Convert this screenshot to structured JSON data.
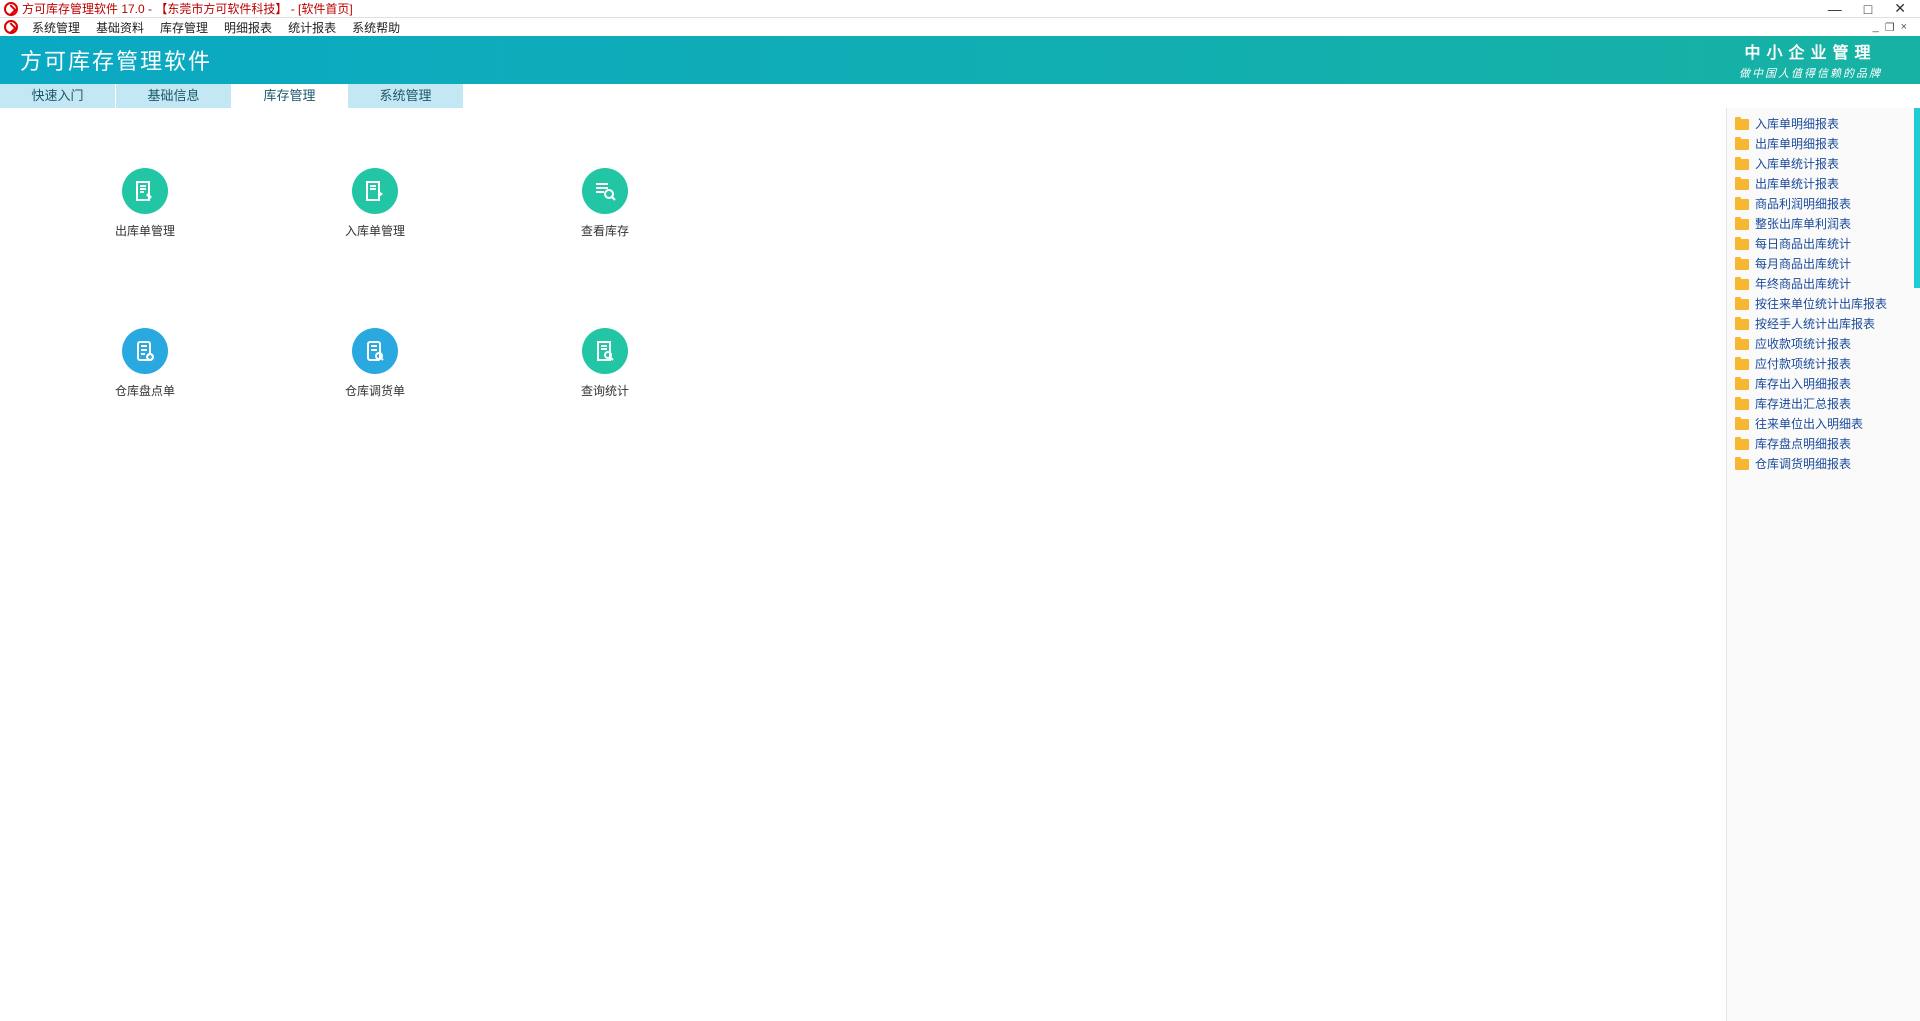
{
  "title_bar": {
    "text": "方可库存管理软件 17.0 - 【东莞市方可软件科技】 - [软件首页]"
  },
  "menu": [
    "系统管理",
    "基础资料",
    "库存管理",
    "明细报表",
    "统计报表",
    "系统帮助"
  ],
  "banner": {
    "brand": "方可库存管理软件",
    "right_line1": "中小企业管理",
    "right_line2": "做中国人值得信赖的品牌"
  },
  "tabs": [
    {
      "label": "快速入门",
      "active": false
    },
    {
      "label": "基础信息",
      "active": false
    },
    {
      "label": "库存管理",
      "active": true
    },
    {
      "label": "系统管理",
      "active": false
    }
  ],
  "icons": [
    {
      "label": "出库单管理",
      "color": "c-teal",
      "name": "outbound-orders",
      "glyph": "doc-pen"
    },
    {
      "label": "入库单管理",
      "color": "c-teal",
      "name": "inbound-orders",
      "glyph": "doc-arrow"
    },
    {
      "label": "查看库存",
      "color": "c-teal",
      "name": "view-inventory",
      "glyph": "list-search"
    },
    {
      "label": "仓库盘点单",
      "color": "c-blue",
      "name": "stock-check",
      "glyph": "clipboard-plus"
    },
    {
      "label": "仓库调货单",
      "color": "c-blue",
      "name": "stock-transfer",
      "glyph": "clipboard-search"
    },
    {
      "label": "查询统计",
      "color": "c-teal",
      "name": "query-stats",
      "glyph": "doc-search"
    }
  ],
  "reports": [
    "入库单明细报表",
    "出库单明细报表",
    "入库单统计报表",
    "出库单统计报表",
    "商品利润明细报表",
    "整张出库单利润表",
    "每日商品出库统计",
    "每月商品出库统计",
    "年终商品出库统计",
    "按往来单位统计出库报表",
    "按经手人统计出库报表",
    "应收款项统计报表",
    "应付款项统计报表",
    "库存出入明细报表",
    "库存进出汇总报表",
    "往来单位出入明细表",
    "库存盘点明细报表",
    "仓库调货明细报表"
  ]
}
